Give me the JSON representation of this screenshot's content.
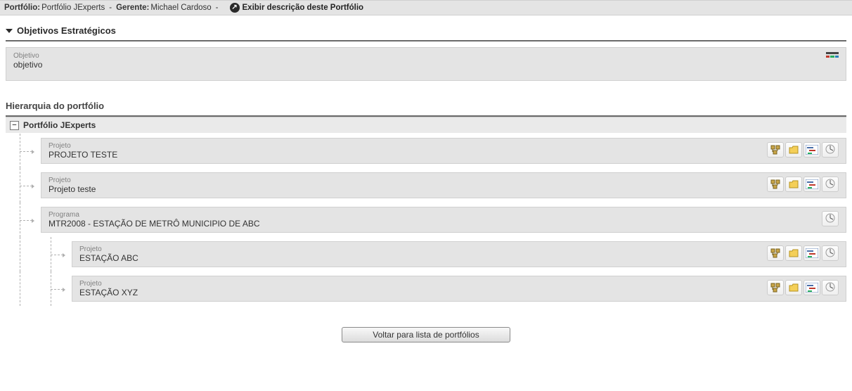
{
  "header": {
    "portfolio_label": "Portfólio:",
    "portfolio_name": "Portfólio JExperts",
    "manager_label": "Gerente:",
    "manager_name": "Michael Cardoso",
    "show_desc": "Exibir descrição deste Portfólio"
  },
  "objectives": {
    "section_title": "Objetivos Estratégicos",
    "item_type": "Objetivo",
    "item_value": "objetivo"
  },
  "hierarchy": {
    "title": "Hierarquia do portfólio",
    "root_name": "Portfólio JExperts",
    "nodes": [
      {
        "type": "Projeto",
        "name": "PROJETO TESTE",
        "depth": 1,
        "actions": [
          "hier",
          "folder",
          "gantt",
          "progress"
        ]
      },
      {
        "type": "Projeto",
        "name": "Projeto teste",
        "depth": 1,
        "actions": [
          "hier",
          "folder",
          "gantt",
          "progress"
        ]
      },
      {
        "type": "Programa",
        "name": "MTR2008 - ESTAÇÃO DE METRÔ MUNICIPIO DE ABC",
        "depth": 1,
        "actions": [
          "progress"
        ]
      },
      {
        "type": "Projeto",
        "name": "ESTAÇÃO ABC",
        "depth": 2,
        "actions": [
          "hier",
          "folder",
          "gantt",
          "progress"
        ]
      },
      {
        "type": "Projeto",
        "name": "ESTAÇÃO XYZ",
        "depth": 2,
        "actions": [
          "hier",
          "folder",
          "gantt",
          "progress"
        ]
      }
    ]
  },
  "footer": {
    "back_button": "Voltar para lista de portfólios"
  }
}
